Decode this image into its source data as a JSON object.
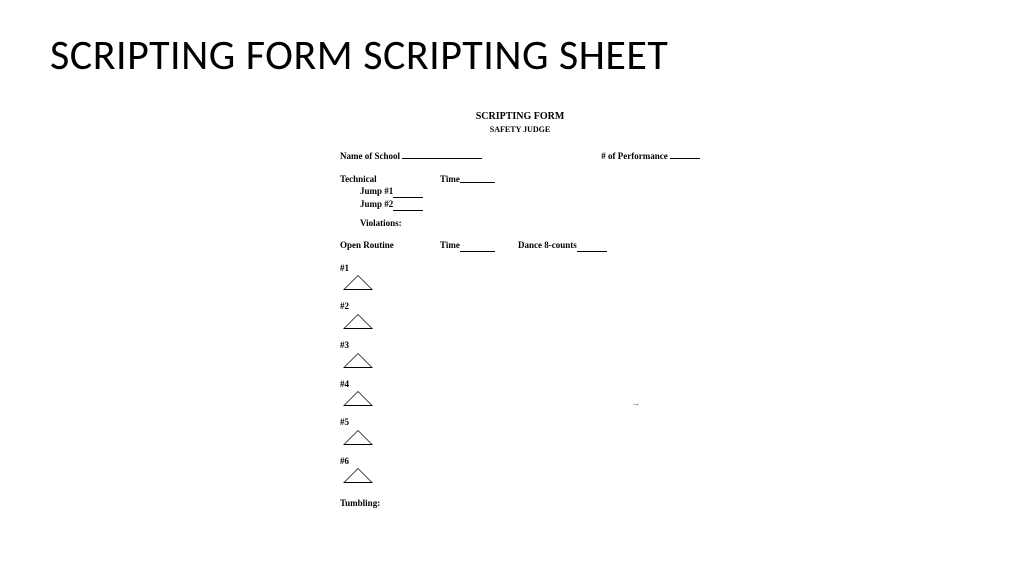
{
  "slide": {
    "title": "SCRIPTING FORM SCRIPTING SHEET"
  },
  "doc": {
    "title": "SCRIPTING FORM",
    "subtitle": "SAFETY JUDGE",
    "school_label": "Name of School",
    "perf_label": "# of Performance",
    "technical": "Technical",
    "time": "Time",
    "jump1": "Jump #1",
    "jump2": "Jump #2",
    "violations": "Violations:",
    "open_routine": "Open Routine",
    "dance8": "Dance 8-counts",
    "stunts": [
      "#1",
      "#2",
      "#3",
      "#4",
      "#5",
      "#6"
    ],
    "tumbling": "Tumbling:",
    "page_arrow": "→"
  }
}
